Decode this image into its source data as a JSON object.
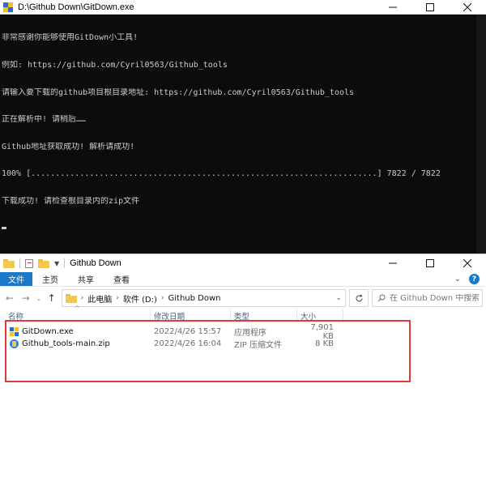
{
  "console": {
    "title": "D:\\Github Down\\GitDown.exe",
    "lines": [
      "非常感谢你能够使用GitDown小工具!",
      "例如: https://github.com/Cyril0563/Github_tools",
      "请输入要下载的github项目根目录地址: https://github.com/Cyril0563/Github_tools",
      "正在解析中! 请稍后……",
      "Github地址获取成功! 解析请成功!",
      "100% [.......................................................................] 7822 / 7822",
      "下载成功! 请检查根目录内的zip文件"
    ]
  },
  "explorer": {
    "title": "Github Down",
    "ribbon": {
      "file_tab": "文件",
      "home_tab": "主页",
      "share_tab": "共享",
      "view_tab": "查看"
    },
    "breadcrumb": [
      "此电脑",
      "软件 (D:)",
      "Github Down"
    ],
    "search_placeholder": "在 Github Down 中搜索",
    "columns": {
      "name": "名称",
      "date": "修改日期",
      "type": "类型",
      "size": "大小"
    },
    "files": [
      {
        "name": "GitDown.exe",
        "date": "2022/4/26 15:57",
        "type": "应用程序",
        "size": "7,901 KB",
        "icon": "exe-icon"
      },
      {
        "name": "Github_tools-main.zip",
        "date": "2022/4/26 16:04",
        "type": "ZIP 压缩文件",
        "size": "8 KB",
        "icon": "zip-icon"
      }
    ]
  },
  "colors": {
    "console_bg": "#0c0c0c",
    "console_text": "#cccccc",
    "ribbon_file": "#1979ca",
    "highlight_box": "#e53939"
  }
}
